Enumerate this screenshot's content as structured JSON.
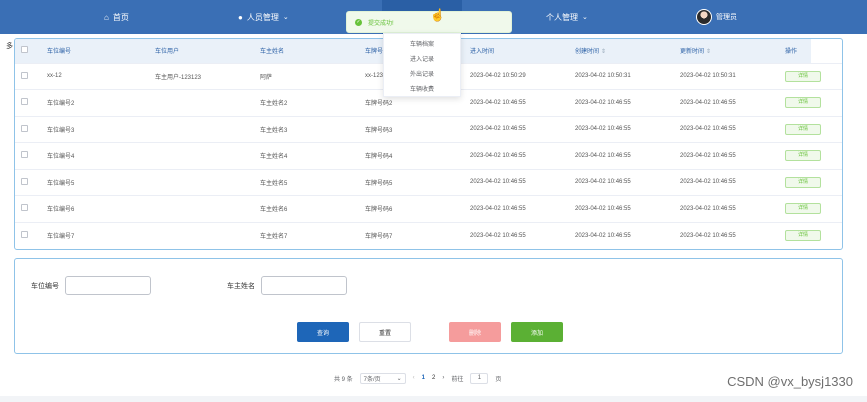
{
  "nav": {
    "home": "首页",
    "people": "人员管理",
    "personal": "个人管理",
    "user": "管理员"
  },
  "toast": {
    "message": "提交成功!"
  },
  "dropdown": {
    "items": [
      "车辆档案",
      "进入记录",
      "外出记录",
      "车辆收费"
    ]
  },
  "side_glyph": "多",
  "table": {
    "headers": [
      "车位编号",
      "车位用户",
      "车主姓名",
      "车牌号码",
      "进入时间",
      "创建时间",
      "更新时间",
      "操作"
    ],
    "rows": [
      [
        "xx-12",
        "车主用户-123123",
        "阿萨",
        "xx-123",
        "2023-04-02 10:50:29",
        "2023-04-02 10:50:31",
        "2023-04-02 10:50:31",
        "详情"
      ],
      [
        "车位编号2",
        "",
        "车主姓名2",
        "车牌号码2",
        "2023-04-02 10:46:55",
        "2023-04-02 10:46:55",
        "2023-04-02 10:46:55",
        "详情"
      ],
      [
        "车位编号3",
        "",
        "车主姓名3",
        "车牌号码3",
        "2023-04-02 10:46:55",
        "2023-04-02 10:46:55",
        "2023-04-02 10:46:55",
        "详情"
      ],
      [
        "车位编号4",
        "",
        "车主姓名4",
        "车牌号码4",
        "2023-04-02 10:46:55",
        "2023-04-02 10:46:55",
        "2023-04-02 10:46:55",
        "详情"
      ],
      [
        "车位编号5",
        "",
        "车主姓名5",
        "车牌号码5",
        "2023-04-02 10:46:55",
        "2023-04-02 10:46:55",
        "2023-04-02 10:46:55",
        "详情"
      ],
      [
        "车位编号6",
        "",
        "车主姓名6",
        "车牌号码6",
        "2023-04-02 10:46:55",
        "2023-04-02 10:46:55",
        "2023-04-02 10:46:55",
        "详情"
      ],
      [
        "车位编号7",
        "",
        "车主姓名7",
        "车牌号码7",
        "2023-04-02 10:46:55",
        "2023-04-02 10:46:55",
        "2023-04-02 10:46:55",
        "详情"
      ]
    ]
  },
  "form": {
    "space_label": "车位编号",
    "space_value": "",
    "owner_label": "车主姓名",
    "owner_value": "",
    "query": "查询",
    "reset": "重置",
    "delete": "删除",
    "add": "添加"
  },
  "pager": {
    "total": "共 9 条",
    "page_size": "7条/页",
    "pages": [
      "1",
      "2"
    ],
    "current": "2",
    "goto_label": "前往",
    "goto_value": "1",
    "page_suffix": "页"
  },
  "watermark": "CSDN @vx_bysj1330",
  "colors": {
    "nav": "#3a6fb5",
    "primary": "#1e66b8",
    "success": "#5bb034",
    "danger": "#f59c9c"
  },
  "icons": {
    "home": "home-icon",
    "user": "user-icon",
    "check": "check-circle-icon",
    "cursor": "hand-pointer-icon"
  }
}
